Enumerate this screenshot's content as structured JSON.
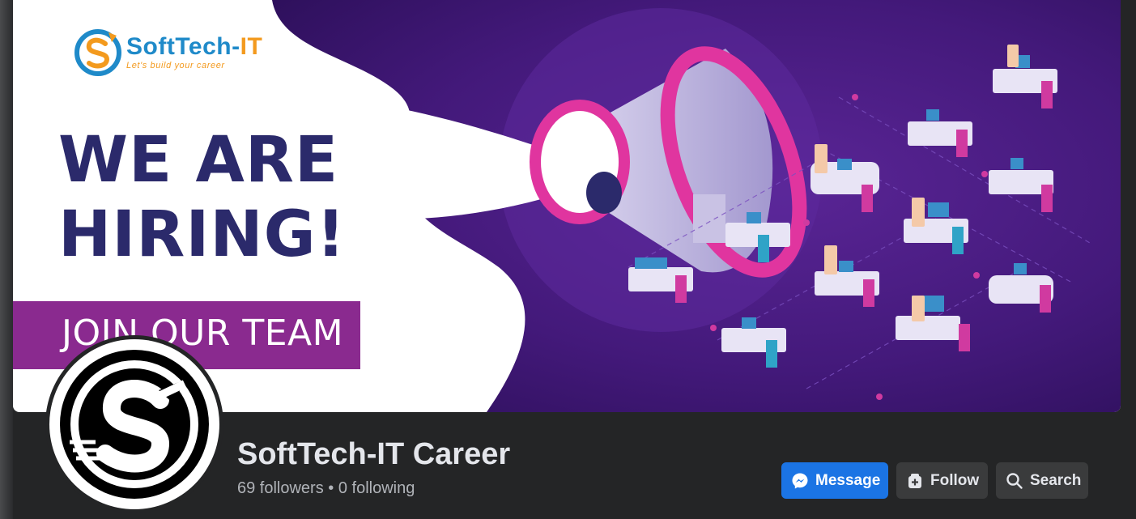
{
  "cover": {
    "logo_name_main": "SoftTech-",
    "logo_name_accent": "IT",
    "logo_tagline": "Let's build your career",
    "headline_line1": "WE ARE",
    "headline_line2": "HIRING!",
    "join_text": "JOIN OUR TEAM"
  },
  "profile": {
    "name": "SoftTech-IT Career",
    "stats": "69 followers • 0 following"
  },
  "actions": {
    "message_label": "Message",
    "follow_label": "Follow",
    "search_label": "Search"
  },
  "colors": {
    "background": "#242526",
    "primary_button": "#1b74e4",
    "secondary_button": "#3a3b3c",
    "cover_purple": "#4b1f86",
    "headline": "#2b2a6b",
    "band": "#8a2a8f"
  },
  "icons": {
    "message": "messenger-icon",
    "follow": "follow-icon",
    "search": "search-icon"
  }
}
